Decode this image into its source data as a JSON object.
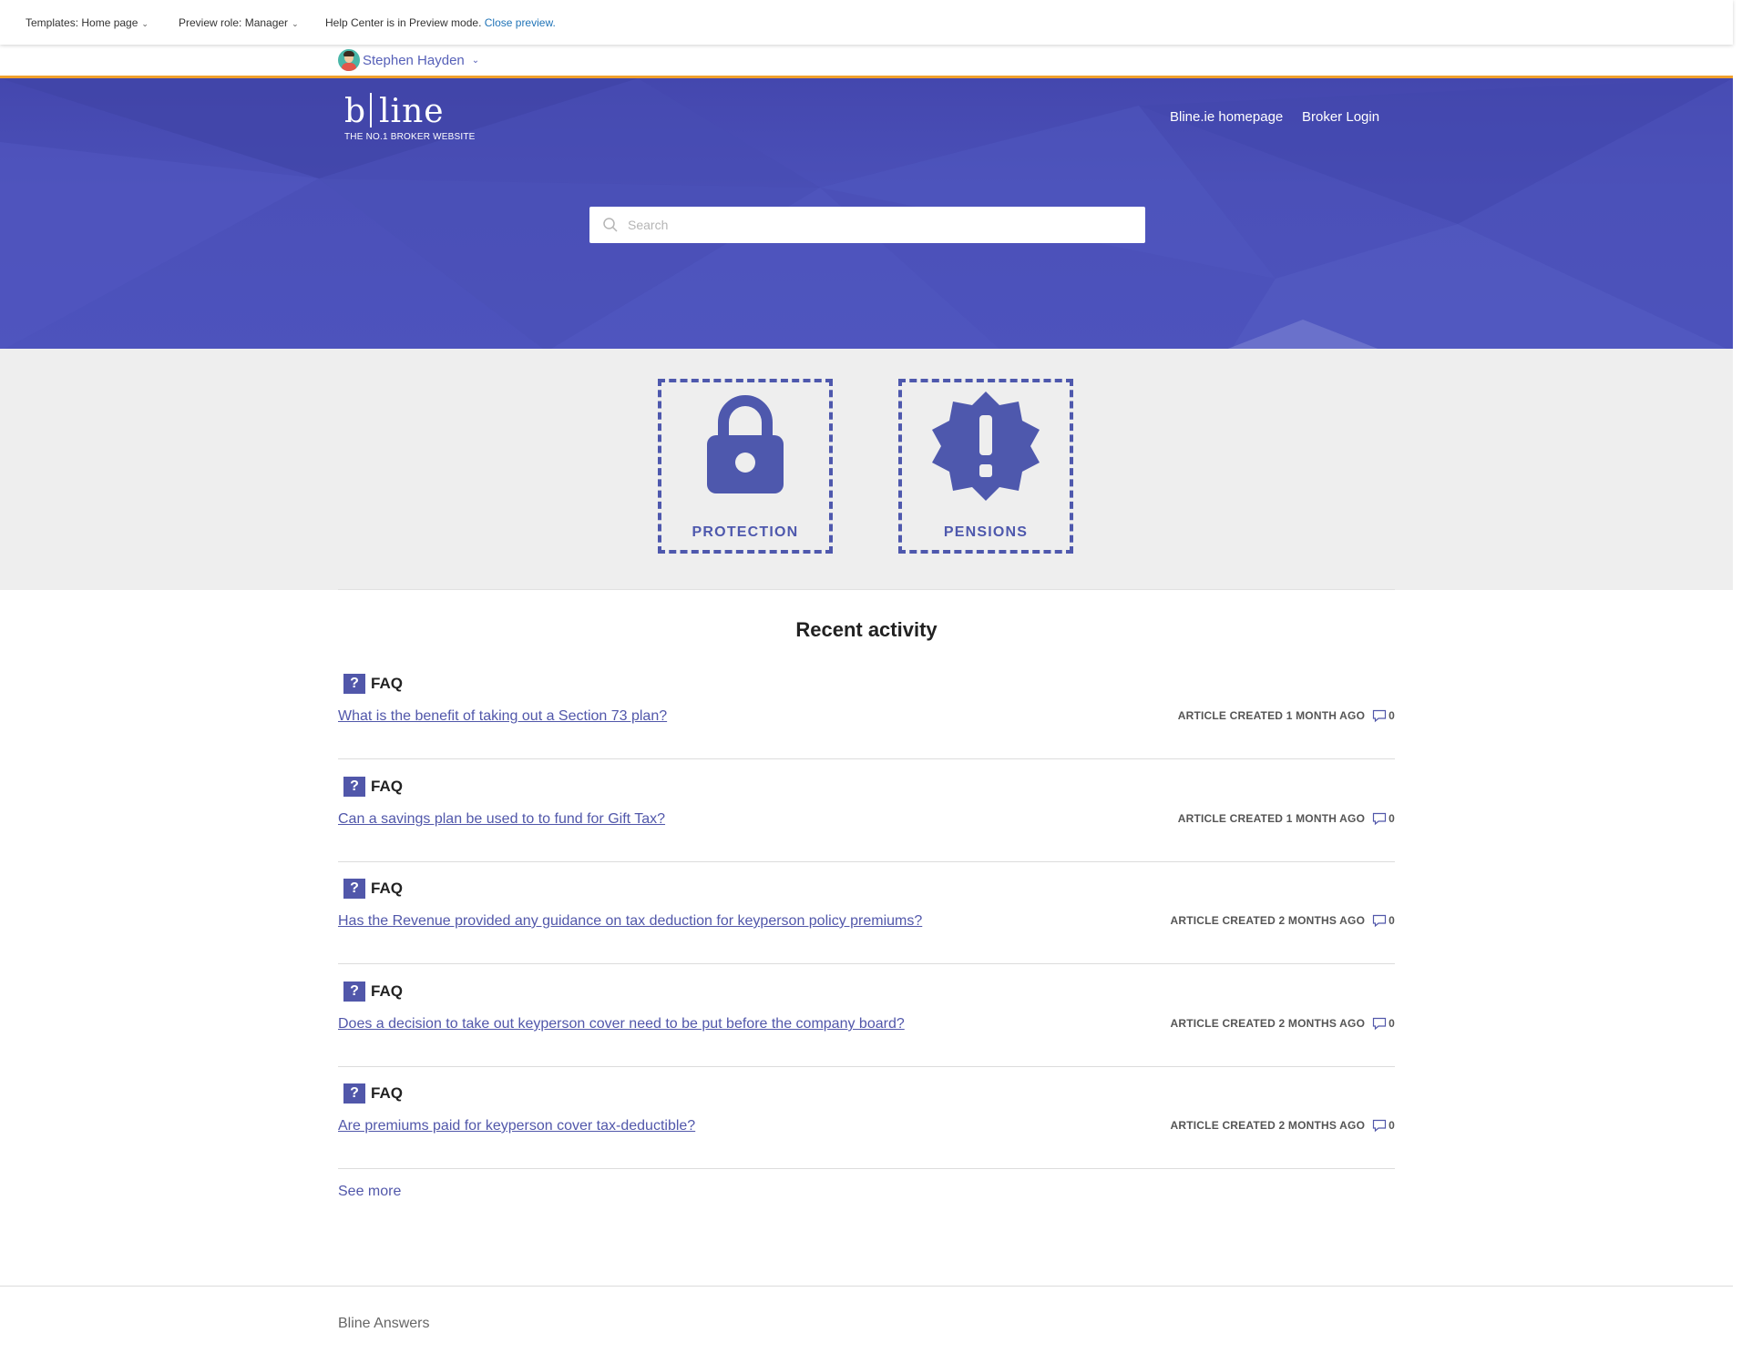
{
  "preview_bar": {
    "templates_label": "Templates: Home page",
    "role_label": "Preview role: Manager",
    "mode_text": "Help Center is in Preview mode.",
    "close_link": "Close preview."
  },
  "user": {
    "name": "Stephen Hayden"
  },
  "header": {
    "logo_b": "b",
    "logo_line": "line",
    "logo_tagline": "THE NO.1 BROKER WEBSITE",
    "nav": [
      "Bline.ie homepage",
      "Broker Login"
    ],
    "accent_color": "#f0a02c",
    "hero_color": "#4b50b8"
  },
  "search": {
    "placeholder": "Search"
  },
  "categories": [
    {
      "label": "PROTECTION",
      "icon": "lock-icon"
    },
    {
      "label": "PENSIONS",
      "icon": "exclamation-badge-icon"
    }
  ],
  "recent_activity": {
    "title": "Recent activity",
    "items": [
      {
        "parent": "FAQ",
        "title": "What is the benefit of taking out a Section 73 plan?",
        "meta": "ARTICLE CREATED 1 MONTH AGO",
        "comments": "0"
      },
      {
        "parent": "FAQ",
        "title": "Can a savings plan be used to to fund for Gift Tax?",
        "meta": "ARTICLE CREATED 1 MONTH AGO",
        "comments": "0"
      },
      {
        "parent": "FAQ",
        "title": "Has the Revenue provided any guidance on tax deduction for keyperson policy premiums?",
        "meta": "ARTICLE CREATED 2 MONTHS AGO",
        "comments": "0"
      },
      {
        "parent": "FAQ",
        "title": "Does a decision to take out keyperson cover need to be put before the company board?",
        "meta": "ARTICLE CREATED 2 MONTHS AGO",
        "comments": "0"
      },
      {
        "parent": "FAQ",
        "title": "Are premiums paid for keyperson cover tax-deductible?",
        "meta": "ARTICLE CREATED 2 MONTHS AGO",
        "comments": "0"
      }
    ],
    "see_more": "See more"
  },
  "footer": {
    "text": "Bline Answers"
  }
}
